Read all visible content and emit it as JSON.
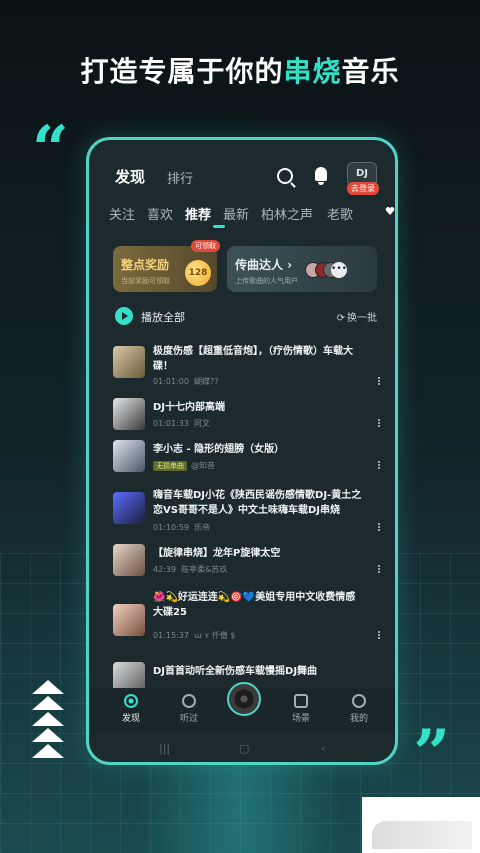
{
  "headline": {
    "prefix": "打造专属于你的",
    "highlight": "串烧",
    "suffix": "音乐"
  },
  "decor": {
    "quote_left": "“",
    "quote_right": "”"
  },
  "app": {
    "top_tabs": {
      "discover": "发现",
      "rank": "排行"
    },
    "avatar_text": "DJ",
    "login_badge": "去登录",
    "categories": [
      "关注",
      "喜欢",
      "推荐",
      "最新",
      "柏林之声",
      "老歌"
    ],
    "active_category": "推荐",
    "reward_card": {
      "title": "整点奖励",
      "subtitle": "当前奖励可领取",
      "coin": "128",
      "badge": "可领取"
    },
    "master_card": {
      "title": "传曲达人 ›",
      "subtitle": "上传歌曲的人气用户"
    },
    "play_all": "播放全部",
    "refresh": "换一批",
    "songs": [
      {
        "title": "极度伤感【超重低音炮】，（疗伤情歌）车载大碟！",
        "time": "01:01:00",
        "uploader": "蝴蝶??",
        "tag": ""
      },
      {
        "title": "DJ十七内部高端",
        "time": "01:01:33",
        "uploader": "阿文",
        "tag": ""
      },
      {
        "title": "李小志 - 隐形的翅膀（女版）",
        "time": "",
        "uploader": "@知音",
        "tag": "无损串曲"
      },
      {
        "title": "嗨音车载DJ小花《陕西民谣伤感情歌DJ-黄土之恋VS哥哥不是人》中文土味嗨车载DJ串烧",
        "time": "01:10:59",
        "uploader": "乐帝",
        "tag": ""
      },
      {
        "title": "【旋律串烧】龙年P旋律太空",
        "time": "42:39",
        "uploader": "陈亭柔&苏玖",
        "tag": ""
      },
      {
        "title": "🌺💫好运连连💫🎯💙美姐专用中文收费情感大碟25",
        "time": "01:15:37",
        "uploader": "ɯ ʏ 仟僧 $",
        "tag": ""
      },
      {
        "title": "DJ首首动听全新伤感车载慢摇DJ舞曲",
        "time": "",
        "uploader": "",
        "tag": ""
      }
    ],
    "tabbar": {
      "discover": "发现",
      "listened": "听过",
      "scene": "场景",
      "mine": "我的"
    }
  }
}
